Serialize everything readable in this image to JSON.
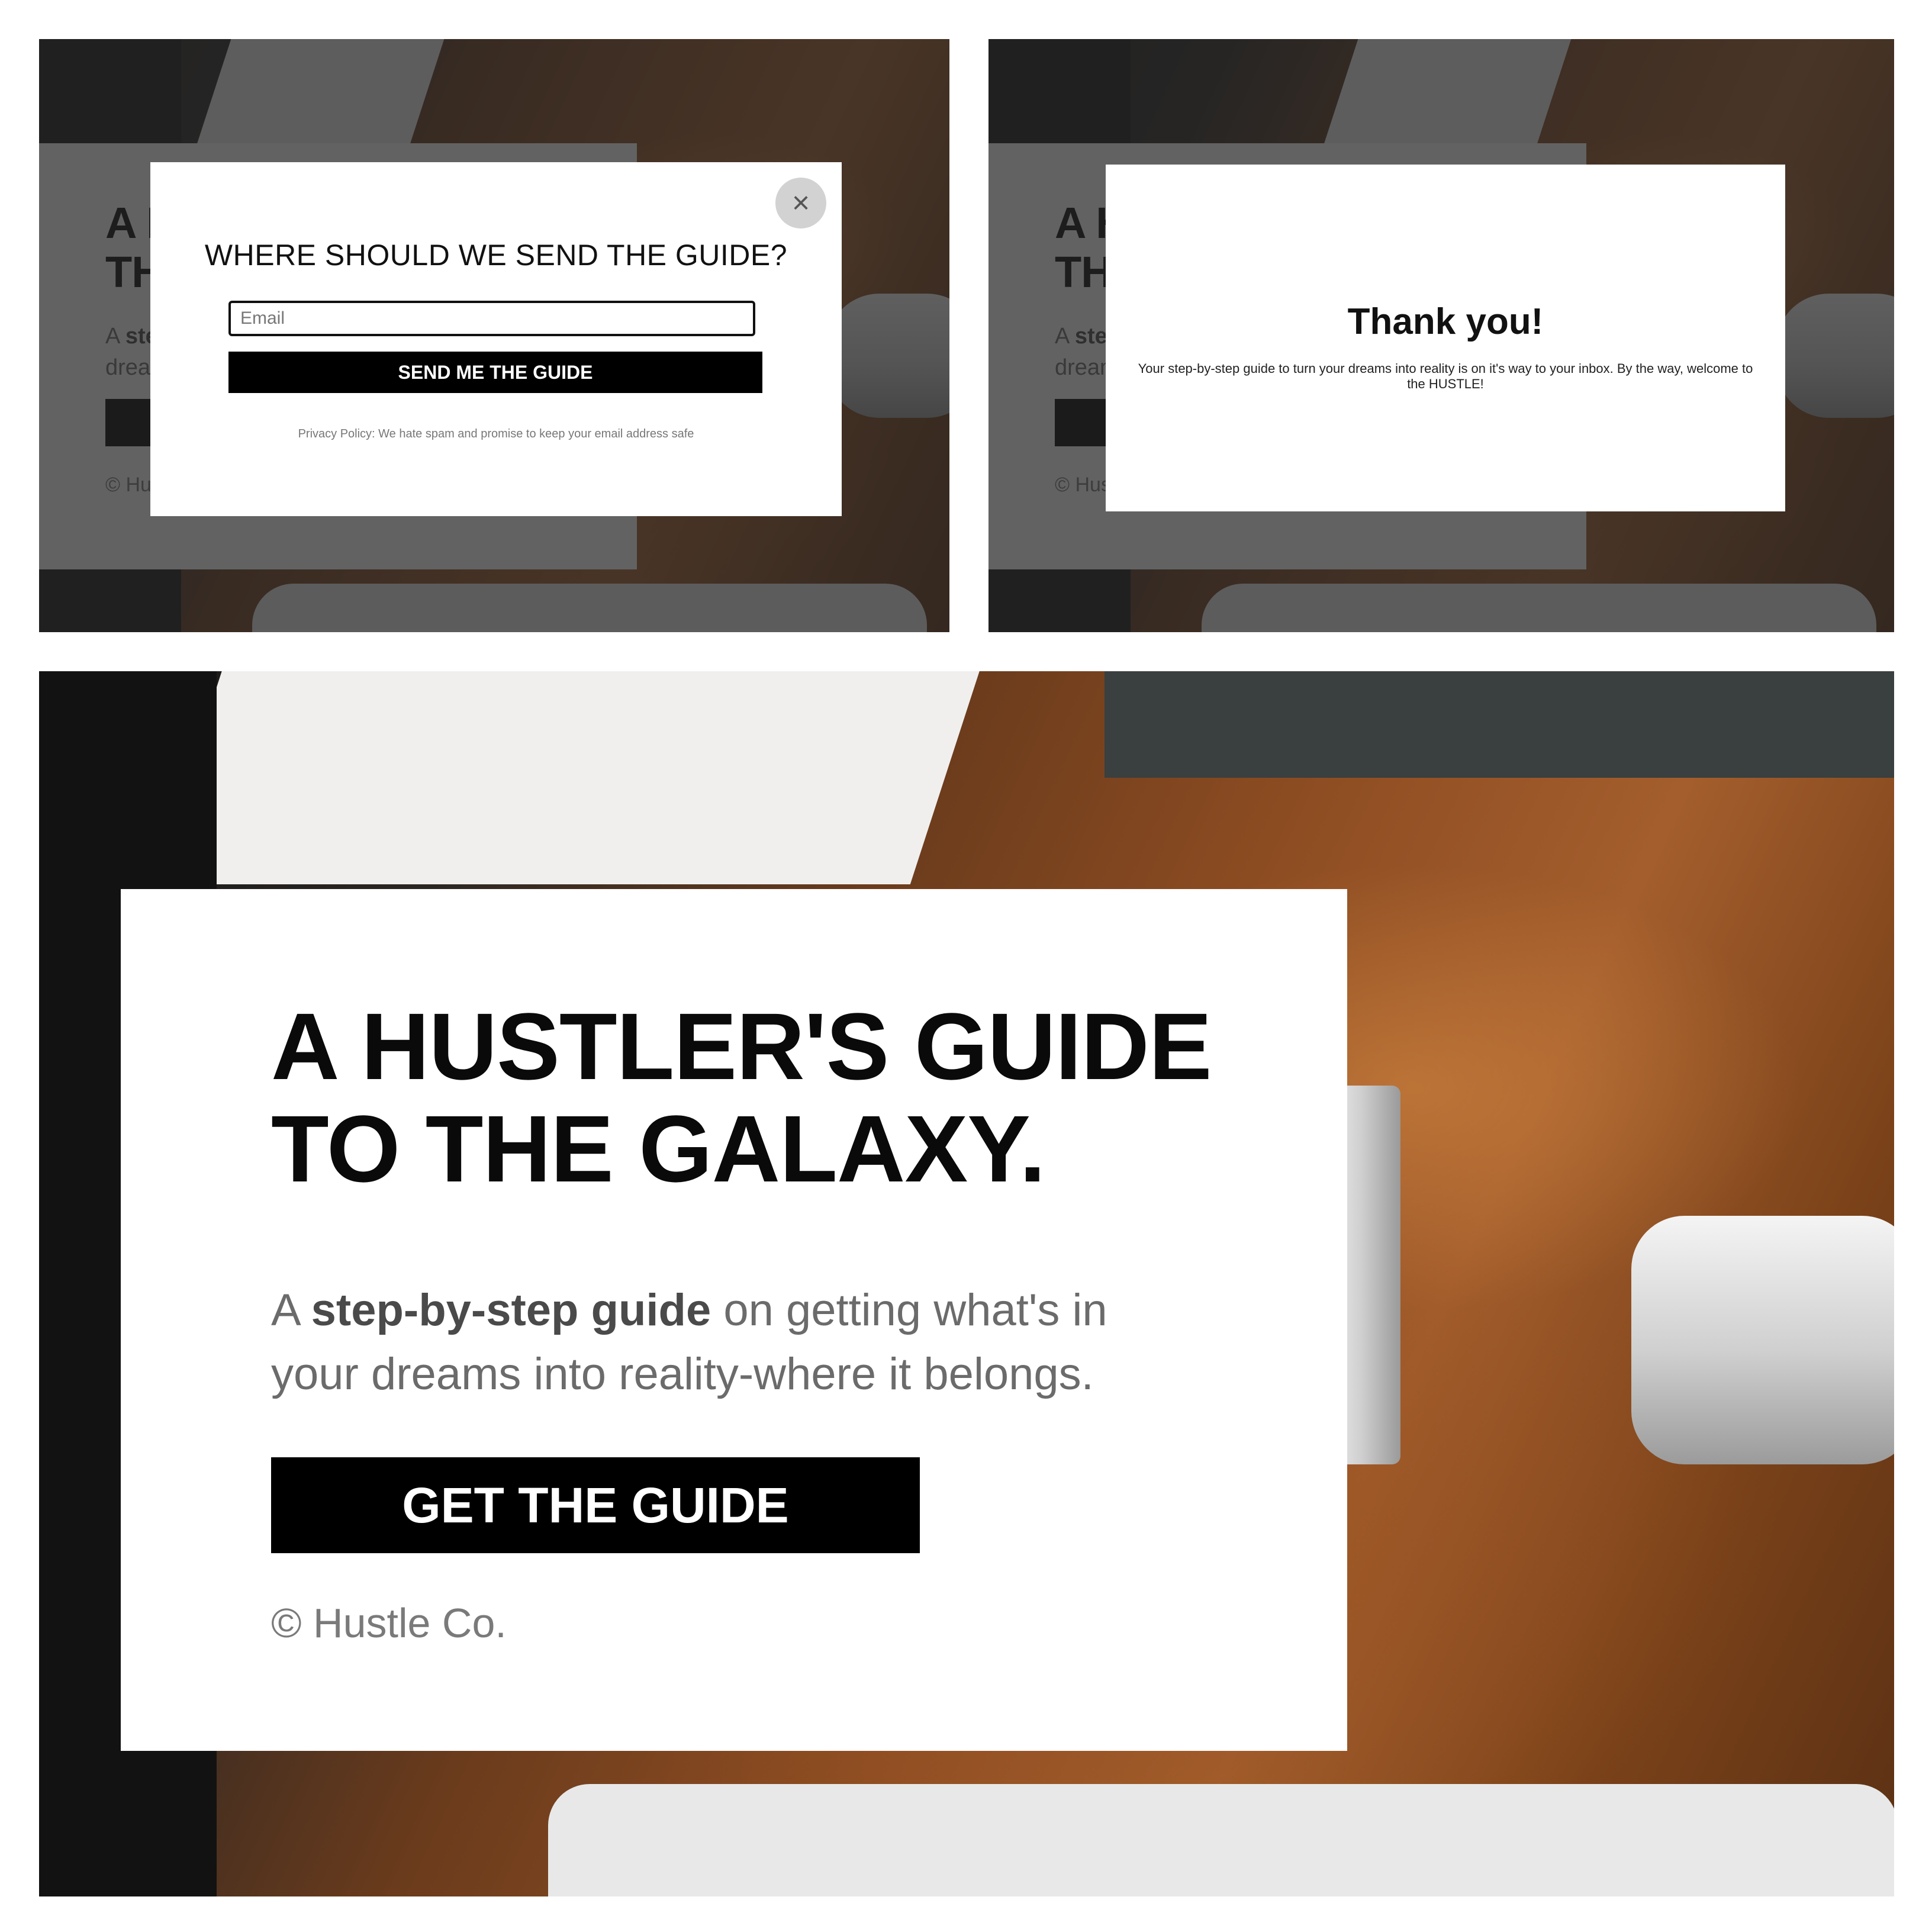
{
  "landing": {
    "title": "A HUSTLER'S GUIDE TO THE GALAXY.",
    "subtitle_prefix": "A ",
    "subtitle_bold": "step-by-step guide",
    "subtitle_rest": " on getting what's in your dreams into reality-where it belongs.",
    "cta_label": "GET THE GUIDE",
    "copyright": "© Hustle Co."
  },
  "modal": {
    "heading": "WHERE SHOULD WE SEND THE GUIDE?",
    "email_placeholder": "Email",
    "submit_label": "SEND ME THE GUIDE",
    "privacy": "Privacy Policy: We hate spam and promise to keep your email address safe",
    "close_icon": "×"
  },
  "thank_you": {
    "heading": "Thank you!",
    "message": "Your step-by-step guide to turn your dreams into reality is on it's way to your inbox. By the way, welcome to the HUSTLE!"
  },
  "colors": {
    "accent": "#000000",
    "text_muted": "#6b6b6b",
    "overlay": "#262626"
  }
}
